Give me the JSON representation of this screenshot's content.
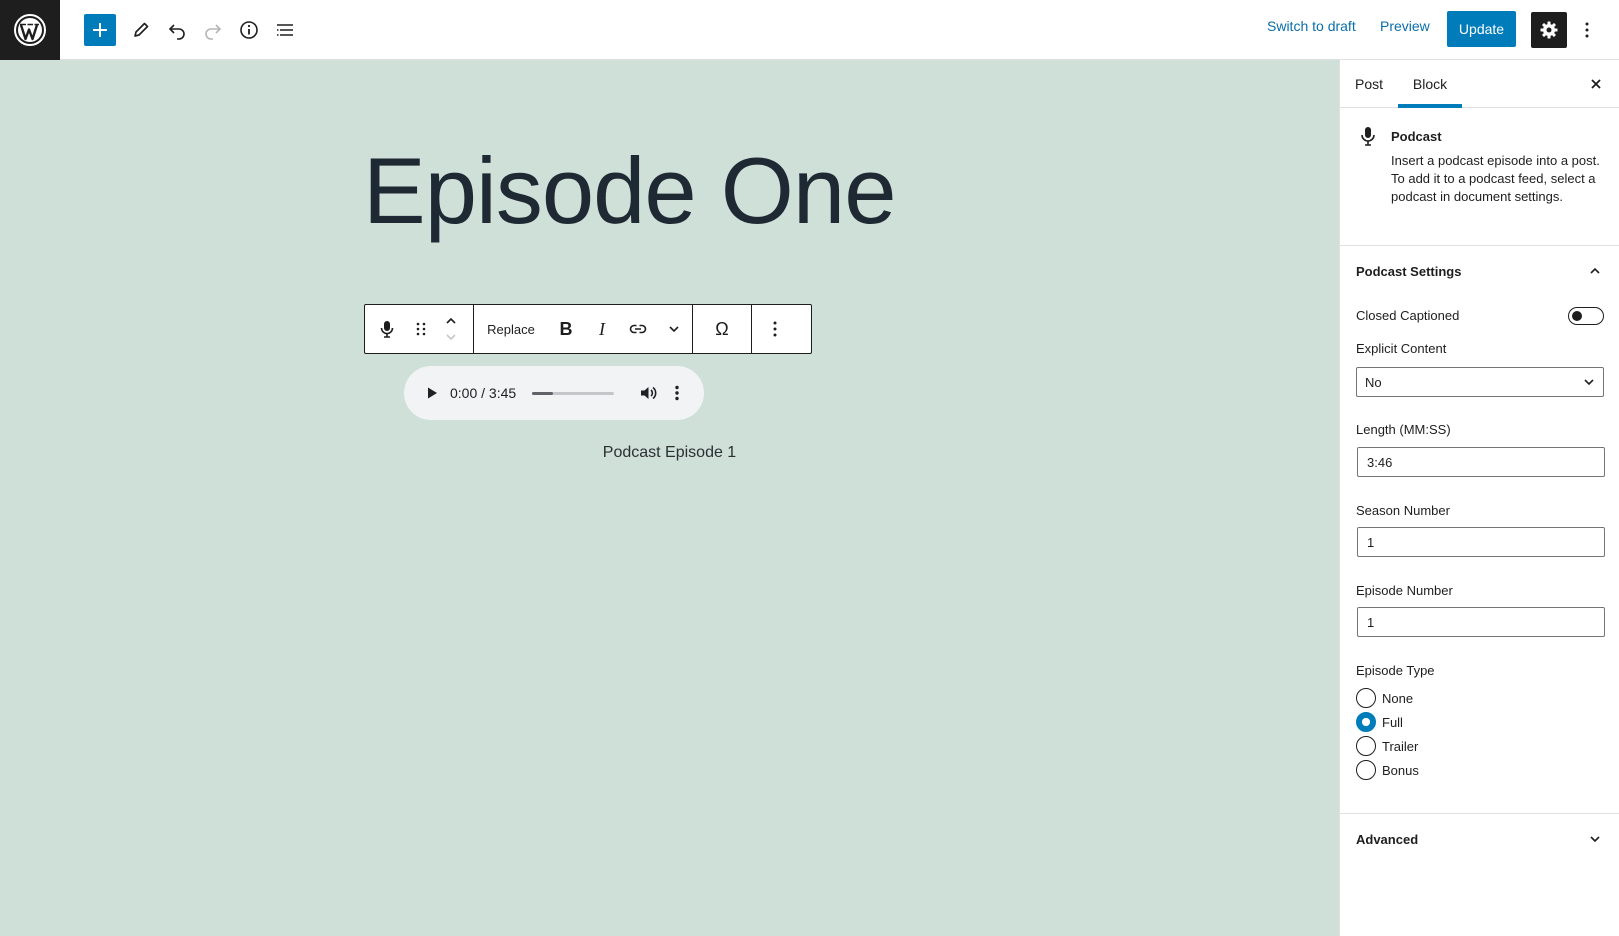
{
  "toolbar": {
    "switch_to_draft": "Switch to draft",
    "preview": "Preview",
    "update": "Update",
    "icons": [
      "wordpress-logo-icon",
      "plus-icon",
      "pencil-icon",
      "undo-icon",
      "redo-icon",
      "info-icon",
      "list-view-icon",
      "gear-icon",
      "more-vertical-icon"
    ]
  },
  "canvas": {
    "post_title": "Episode One",
    "background_color": "#cee0d8",
    "block_toolbar": {
      "replace_label": "Replace",
      "bold_label": "B",
      "italic_label": "I",
      "special_char_label": "Ω"
    },
    "audio": {
      "time": "0:00 / 3:45",
      "progress": 0.25
    },
    "caption": "Podcast Episode 1"
  },
  "sidebar": {
    "tabs": [
      {
        "label": "Post",
        "active": false
      },
      {
        "label": "Block",
        "active": true
      }
    ],
    "block": {
      "title": "Podcast",
      "description": "Insert a podcast episode into a post. To add it to a podcast feed, select a podcast in document settings."
    },
    "podcast_settings": {
      "title": "Podcast Settings",
      "closed_captioned_label": "Closed Captioned",
      "closed_captioned": false,
      "explicit_label": "Explicit Content",
      "explicit_value": "No",
      "length_label": "Length (MM:SS)",
      "length_value": "3:46",
      "season_label": "Season Number",
      "season_value": "1",
      "episode_label": "Episode Number",
      "episode_value": "1",
      "episode_type_label": "Episode Type",
      "episode_types": [
        {
          "label": "None",
          "checked": false
        },
        {
          "label": "Full",
          "checked": true
        },
        {
          "label": "Trailer",
          "checked": false
        },
        {
          "label": "Bonus",
          "checked": false
        }
      ]
    },
    "advanced": {
      "title": "Advanced"
    }
  },
  "colors": {
    "accent": "#007cba",
    "dark": "#1e1e1e"
  }
}
